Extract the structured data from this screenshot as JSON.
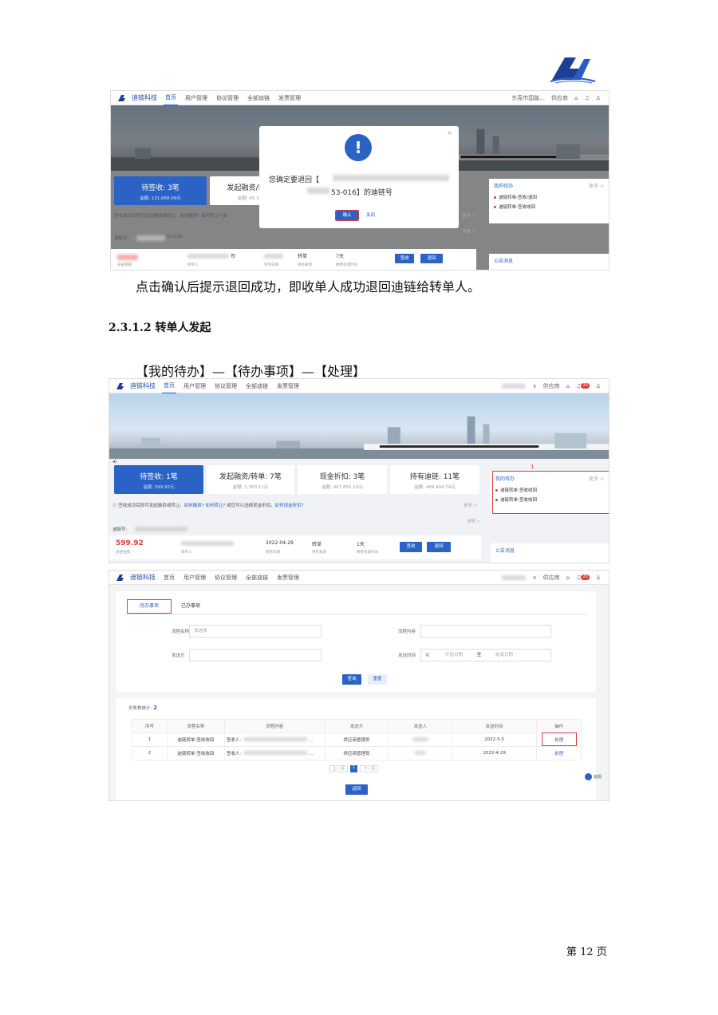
{
  "shot1": {
    "nav": {
      "brand": "迪链科技",
      "items": [
        "首页",
        "用户管理",
        "协议管理",
        "全部迪链",
        "发票管理"
      ],
      "right_user": "东莞市国能...",
      "right_role": "供应商"
    },
    "stats": [
      {
        "title": "待签收: 3笔",
        "sub": "金额: 131,668.09元"
      },
      {
        "title": "发起融资/转单",
        "sub": "金额: 45,14"
      }
    ],
    "tip": "签收成功后即可发起融资或转让。如何融资? 如何转让? 或",
    "side": {
      "title": "我的待办",
      "more": "更多 >",
      "items": [
        "迪链转单-签收/退回",
        "迪链转单-签收收回"
      ]
    },
    "chain_label": "迪链号:",
    "chain_no": "53-016",
    "more_link": "更多 >",
    "detail_link": "详情 >",
    "row": {
      "amount_label": "迪链金额",
      "company_label": "转单人",
      "date_label": "转单日期",
      "type": "转单",
      "type_label": "持有来源",
      "days": "7天",
      "days_label": "剩余签收时间",
      "sign": "签收",
      "back": "退回",
      "company_suffix": "司"
    },
    "notice": "公告消息",
    "modal": {
      "text_a": "您确定要退回【",
      "text_b": "53-016】的迪链号",
      "confirm": "确认",
      "close": "关闭"
    }
  },
  "para1": "点击确认后提示退回成功，即收单人成功退回迪链给转单人。",
  "heading": "2.3.1.2 转单人发起",
  "para2": "【我的待办】—【待办事项】—【处理】",
  "shot2": {
    "nav": {
      "brand": "迪链科技",
      "items": [
        "首页",
        "用户管理",
        "协议管理",
        "全部迪链",
        "发票管理"
      ],
      "right_role": "供应商",
      "badge": "20"
    },
    "stats": [
      {
        "title": "待签收: 1笔",
        "sub": "金额: 599.92元"
      },
      {
        "title": "发起融资/转单: 7笔",
        "sub": "金额: 1,350.11元"
      },
      {
        "title": "现金折扣: 3笔",
        "sub": "金额: 467,855.13元"
      },
      {
        "title": "持有迪链: 11笔",
        "sub": "金额: 469,404.74元"
      }
    ],
    "tip_a": "签收成功后即可发起融资或转让。",
    "tip_links": "如何融资? 如何转让?",
    "tip_b": "或您可以选择现金折扣。",
    "tip_link2": "如何现金折扣?",
    "more": "更多 >",
    "detail": "详情 >",
    "side_marker": "1",
    "side": {
      "title": "我的待办",
      "more": "更多 >",
      "items": [
        "迪链转单-签收收回",
        "迪链转单-签收收回"
      ]
    },
    "chain_label": "迪链号:",
    "row": {
      "amount": "599.92",
      "amount_label": "迪链金额",
      "company_label": "转单人",
      "date": "2022-04-29",
      "date_label": "转单日期",
      "type": "转单",
      "type_label": "持有来源",
      "days": "1天",
      "days_label": "剩余签收时间",
      "sign": "签收",
      "back": "退回"
    },
    "notice": "公告消息"
  },
  "shot3": {
    "nav": {
      "brand": "迪链科技",
      "items": [
        "首页",
        "用户管理",
        "协议管理",
        "全部迪链",
        "发票管理"
      ],
      "right_role": "供应商",
      "badge": "20"
    },
    "tabs": [
      "待办事项",
      "已办事项"
    ],
    "fields": {
      "process_name": "流程名称",
      "process_name_ph": "请选择",
      "process_content": "流程内容",
      "sender": "发送方",
      "send_time": "发送时间",
      "start_ph": "开始日期",
      "to": "至",
      "end_ph": "结束日期"
    },
    "query": "查询",
    "reset": "重置",
    "total_label": "总条数统计:",
    "total": "2",
    "headers": [
      "序号",
      "流程名称",
      "流程内容",
      "发送方",
      "发送人",
      "发送时间",
      "操作"
    ],
    "rows": [
      {
        "no": "1",
        "name": "迪链转单-签收收回",
        "content": "签收人:",
        "sender": "供应商管理员",
        "time": "2022-5-5",
        "op": "处理"
      },
      {
        "no": "2",
        "name": "迪链转单-签收收回",
        "content": "签收人:",
        "sender": "供应商管理员",
        "time": "2022-4-29",
        "op": "处理"
      }
    ],
    "prev": "上一页",
    "page": "1",
    "next": "下一页",
    "back": "返回",
    "help": "客服"
  },
  "footer": "第 12 页"
}
